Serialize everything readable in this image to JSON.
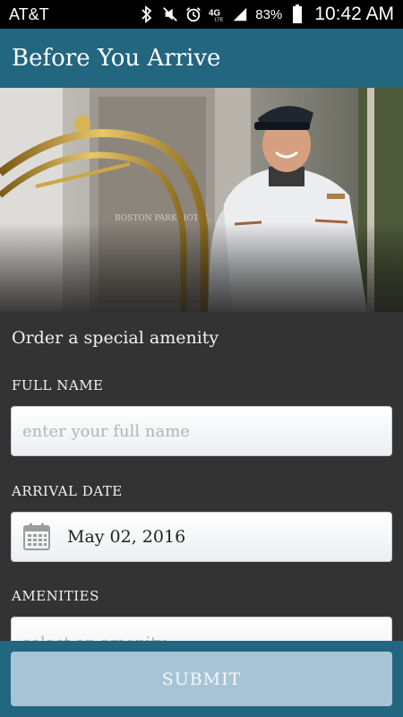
{
  "status_bar": {
    "carrier": "AT&T",
    "network": "4G LTE",
    "battery_percent": "83%",
    "time": "10:42 AM",
    "icons": [
      "bluetooth-icon",
      "vibrate-icon",
      "alarm-icon",
      "lte-icon",
      "signal-icon",
      "battery-icon"
    ]
  },
  "header": {
    "title": "Before You Arrive"
  },
  "form": {
    "section_title": "Order a special amenity",
    "full_name": {
      "label": "FULL NAME",
      "placeholder": "enter your full name",
      "value": ""
    },
    "arrival_date": {
      "label": "ARRIVAL DATE",
      "value": "May 02, 2016",
      "icon": "calendar-icon"
    },
    "amenities": {
      "label": "AMENITIES",
      "placeholder": "select an amenity"
    }
  },
  "footer": {
    "submit_label": "SUBMIT"
  },
  "colors": {
    "app_bar": "#226680",
    "background": "#333333",
    "submit_button": "#a7c4d6",
    "text_light": "#f2f2f2"
  }
}
